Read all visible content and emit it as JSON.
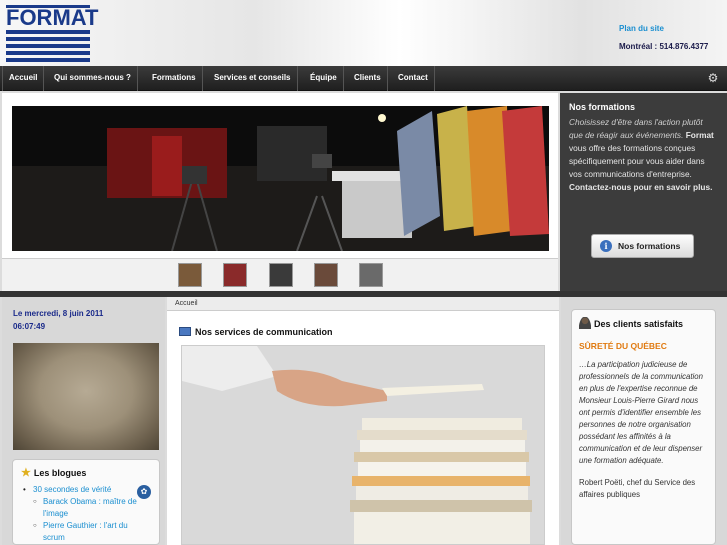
{
  "header": {
    "logo_text": "FORMAT",
    "sitemap_label": "Plan du site",
    "phone": "Montréal : 514.876.4377"
  },
  "nav": {
    "items": [
      {
        "label": "Accueil"
      },
      {
        "label": "Qui sommes-nous ?"
      },
      {
        "label": "Formations"
      },
      {
        "label": "Services et conseils"
      },
      {
        "label": "Équipe"
      },
      {
        "label": "Clients"
      },
      {
        "label": "Contact"
      }
    ],
    "settings_icon": "gear-icon"
  },
  "slider": {
    "thumbnail_count": 5
  },
  "promo": {
    "title": "Nos formations",
    "text_italic": "Choisissez d'être dans l'action plutôt que de réagir aux événements.",
    "brand": "Format",
    "text_rest": "vous offre des formations conçues spécifiquement pour vous aider dans vos communications d'entreprise.",
    "cta_text": "Contactez-nous pour en savoir plus.",
    "button_label": "Nos formations",
    "button_icon": "info-icon"
  },
  "left": {
    "date_line1": "Le mercredi, 8 juin 2011",
    "date_line2": "06:07:49",
    "blogs_title": "Les blogues",
    "blogs": [
      {
        "label": "30 secondes de vérité",
        "level": 1
      },
      {
        "label": "Barack Obama : maître de l'image",
        "level": 2
      },
      {
        "label": "Pierre Gauthier : l'art du scrum",
        "level": 2
      }
    ]
  },
  "main": {
    "breadcrumb": "Accueil",
    "section_title": "Nos services de communication"
  },
  "right": {
    "title": "Des clients satisfaits",
    "client": "SÛRETÉ DU QUÉBEC",
    "quote": "…La participation judicieuse de professionnels de la communication en plus de l'expertise reconnue de Monsieur Louis-Pierre Girard nous ont permis d'identifier ensemble les personnes de notre organisation possédant les affinités à la communication et de leur dispenser une formation adéquate.",
    "author": "Robert Poëti, chef du Service des affaires publiques"
  },
  "colors": {
    "brand_blue": "#1a3a8a",
    "link_blue": "#1b8fd0",
    "client_orange": "#e07a10",
    "nav_bg": "#2a2a2a"
  }
}
